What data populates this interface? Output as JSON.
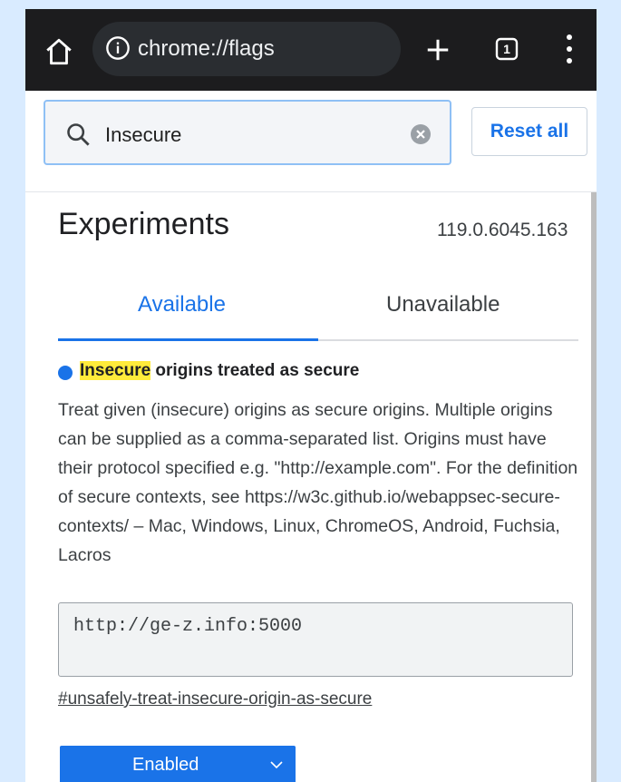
{
  "topbar": {
    "url": "chrome://flags",
    "tab_count": "1"
  },
  "search": {
    "value": "Insecure",
    "reset_label": "Reset all"
  },
  "main": {
    "title": "Experiments",
    "version": "119.0.6045.163",
    "tabs": [
      {
        "label": "Available",
        "active": true
      },
      {
        "label": "Unavailable",
        "active": false
      }
    ]
  },
  "flag": {
    "title_highlight": "Insecure",
    "title_rest": " origins treated as secure",
    "description": "Treat given (insecure) origins as secure origins. Multiple origins can be supplied as a comma-separated list. Origins must have their protocol specified e.g. \"http://example.com\". For the definition of secure contexts, see https://w3c.github.io/webappsec-secure-contexts/ – Mac, Windows, Linux, ChromeOS, Android, Fuchsia, Lacros",
    "input_value": "http://ge-z.info:5000",
    "link": "#unsafely-treat-insecure-origin-as-secure",
    "state": "Enabled"
  },
  "colors": {
    "accent": "#1a73e8",
    "highlight": "#ffeb3b",
    "topbar": "#1c1c1e"
  },
  "icons": [
    "home-icon",
    "info-icon",
    "plus-icon",
    "tabs-icon",
    "menu-icon",
    "search-icon",
    "clear-icon",
    "chevron-down-icon"
  ]
}
